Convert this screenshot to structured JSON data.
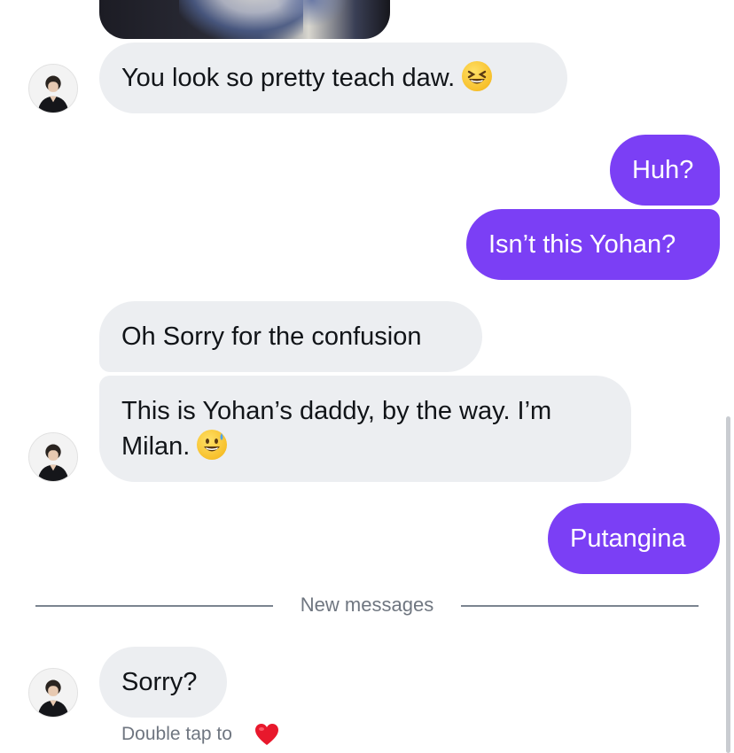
{
  "messages": [
    {
      "sender": "other",
      "text": "You look so pretty teach daw.",
      "emoji": "grinning-squinting-face"
    },
    {
      "sender": "me",
      "text": "Huh?"
    },
    {
      "sender": "me",
      "text": "Isn’t this Yohan?"
    },
    {
      "sender": "other",
      "text": "Oh Sorry for the confusion"
    },
    {
      "sender": "other",
      "line1": "This is Yohan’s daddy, by the way. I’m",
      "line2": "Milan.",
      "emoji": "grinning-face-with-sweat"
    },
    {
      "sender": "me",
      "text": "Putangina"
    },
    {
      "sender": "other",
      "text": "Sorry?"
    }
  ],
  "divider": {
    "label": "New messages"
  },
  "hint": {
    "text": "Double tap to",
    "icon": "heart-icon"
  },
  "colors": {
    "outgoing": "#7b3ff5",
    "incoming": "#eceef1",
    "divider": "#7b8490"
  }
}
